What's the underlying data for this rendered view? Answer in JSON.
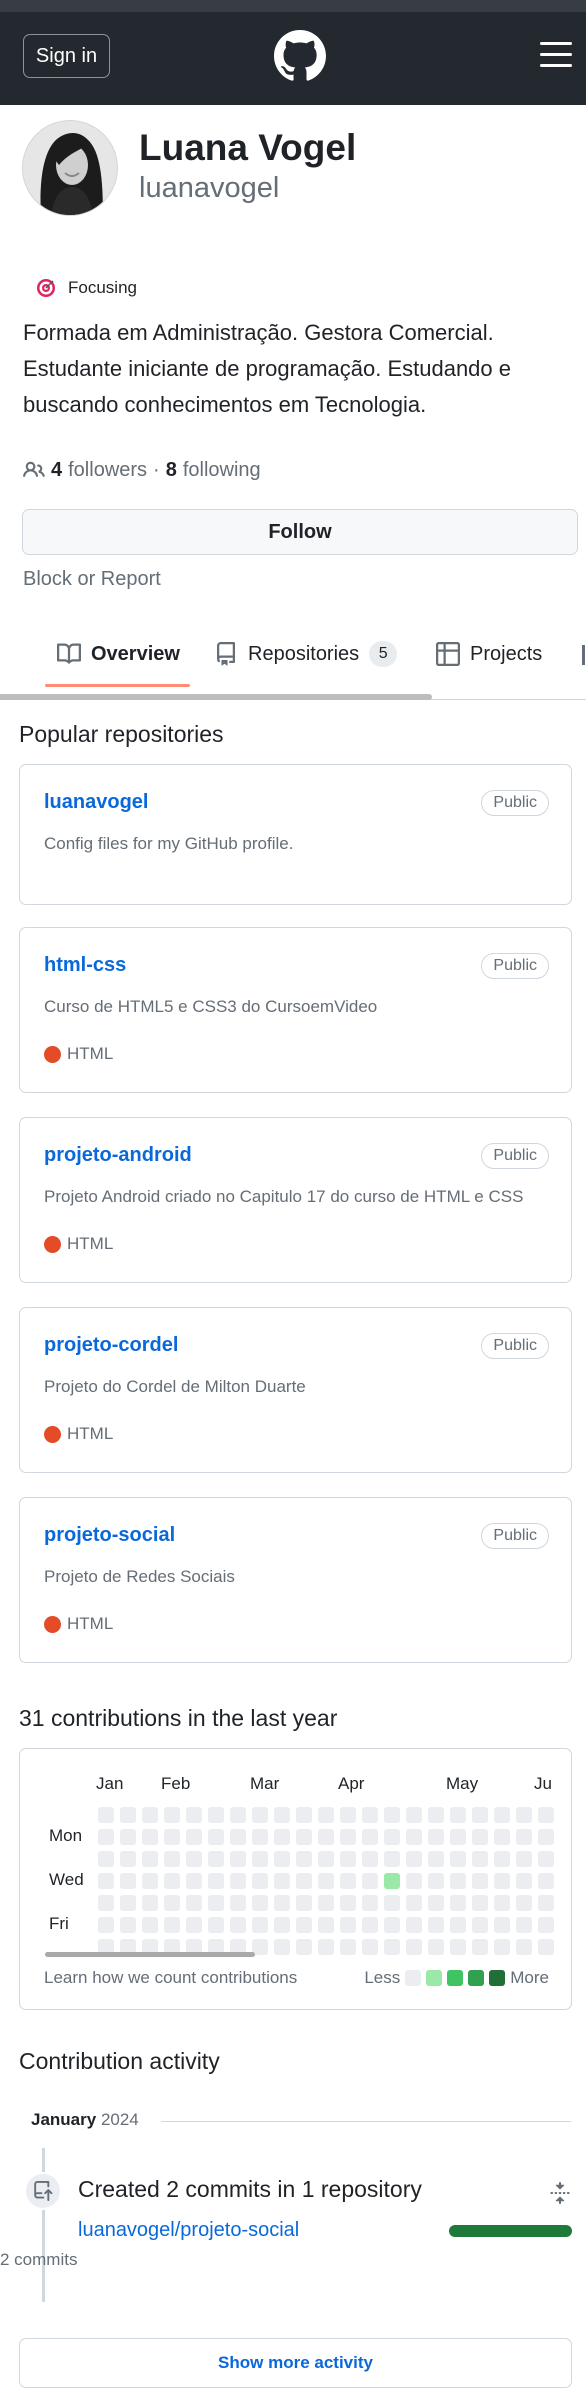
{
  "header": {
    "sign_in_label": "Sign in"
  },
  "profile": {
    "full_name": "Luana Vogel",
    "username": "luanavogel",
    "status_text": "Focusing",
    "bio": "Formada em Administração. Gestora Comercial. Estudante iniciante de programação. Estudando e buscando conhecimentos em Tecnologia.",
    "followers_count": "4",
    "followers_label": "followers",
    "separator": "·",
    "following_count": "8",
    "following_label": "following",
    "follow_button_label": "Follow",
    "block_report_label": "Block or Report"
  },
  "tabs": [
    {
      "label": "Overview",
      "active": true
    },
    {
      "label": "Repositories",
      "count": "5"
    },
    {
      "label": "Projects"
    }
  ],
  "popular": {
    "title": "Popular repositories",
    "repos": [
      {
        "name": "luanavogel",
        "visibility": "Public",
        "description": "Config files for my GitHub profile.",
        "language": ""
      },
      {
        "name": "html-css",
        "visibility": "Public",
        "description": "Curso de HTML5 e CSS3 do CursoemVideo",
        "language": "HTML"
      },
      {
        "name": "projeto-android",
        "visibility": "Public",
        "description": "Projeto Android criado no Capitulo 17 do curso de HTML e CSS",
        "language": "HTML"
      },
      {
        "name": "projeto-cordel",
        "visibility": "Public",
        "description": "Projeto do Cordel de Milton Duarte",
        "language": "HTML"
      },
      {
        "name": "projeto-social",
        "visibility": "Public",
        "description": "Projeto de Redes Sociais",
        "language": "HTML"
      }
    ],
    "language_color": "#e34c26"
  },
  "contributions": {
    "title": "31 contributions in the last year",
    "months": [
      "Jan",
      "Feb",
      "Mar",
      "Apr",
      "May",
      "Ju"
    ],
    "days": [
      "Mon",
      "Wed",
      "Fri"
    ],
    "active_cell_week": 13,
    "active_cell_day": 3,
    "learn_label": "Learn how we count contributions",
    "less_label": "Less",
    "more_label": "More",
    "legend_colors": [
      "#ebedf0",
      "#9be9a8",
      "#40c463",
      "#30a14e",
      "#216e39"
    ]
  },
  "activity": {
    "title": "Contribution activity",
    "month_label": "January",
    "year_label": "2024",
    "event_title": "Created 2 commits in 1 repository",
    "repo_link": "luanavogel/projeto-social",
    "commits_label": "2 commits",
    "bar_color": "#1f7a3a",
    "show_more_label": "Show more activity"
  }
}
